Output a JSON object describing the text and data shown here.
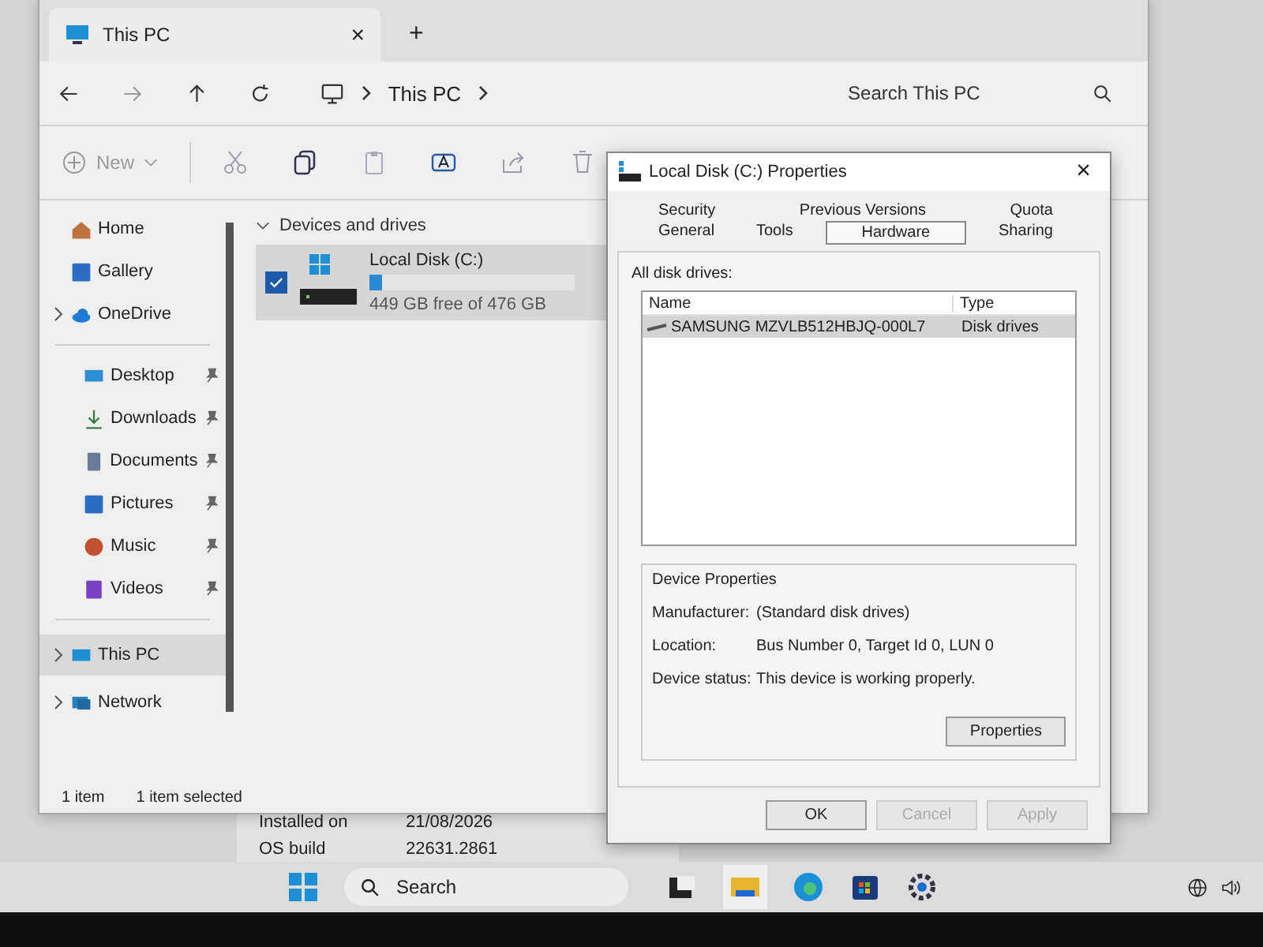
{
  "explorer": {
    "tab_title": "This PC",
    "new_tab": "+",
    "close": "×",
    "breadcrumb": "This PC",
    "search": {
      "placeholder": "Search This PC"
    },
    "new_label": "New",
    "sidebar": [
      {
        "label": "Home",
        "expandable": false,
        "pinned": false,
        "selected": false
      },
      {
        "label": "Gallery",
        "expandable": false,
        "pinned": false,
        "selected": false
      },
      {
        "label": "OneDrive",
        "expandable": true,
        "pinned": false,
        "selected": false
      },
      {
        "label": "Desktop",
        "expandable": false,
        "pinned": true,
        "selected": false
      },
      {
        "label": "Downloads",
        "expandable": false,
        "pinned": true,
        "selected": false
      },
      {
        "label": "Documents",
        "expandable": false,
        "pinned": true,
        "selected": false
      },
      {
        "label": "Pictures",
        "expandable": false,
        "pinned": true,
        "selected": false
      },
      {
        "label": "Music",
        "expandable": false,
        "pinned": true,
        "selected": false
      },
      {
        "label": "Videos",
        "expandable": false,
        "pinned": true,
        "selected": false
      },
      {
        "label": "This PC",
        "expandable": true,
        "pinned": false,
        "selected": true
      },
      {
        "label": "Network",
        "expandable": true,
        "pinned": false,
        "selected": false
      }
    ],
    "section": "Devices and drives",
    "drives": [
      {
        "name": "Local Disk (C:)",
        "free": "449 GB free of 476 GB",
        "level": 0.06,
        "checked": true,
        "selected": true
      }
    ],
    "status": [
      "1 item",
      "1 item selected"
    ]
  },
  "settings_behind": {
    "rows": [
      {
        "label": "Installed on",
        "value": "21/08/2026"
      },
      {
        "label": "OS build",
        "value": "22631.2861"
      }
    ]
  },
  "dialog": {
    "title": "Local Disk (C:) Properties",
    "close": "×",
    "tab_rows": [
      [
        {
          "label": "Security",
          "selected": false
        },
        {
          "label": "Previous Versions",
          "selected": false
        },
        {
          "label": "Quota",
          "selected": false
        }
      ],
      [
        {
          "label": "General",
          "selected": false
        },
        {
          "label": "Tools",
          "selected": false
        },
        {
          "label": "Hardware",
          "selected": true
        },
        {
          "label": "Sharing",
          "selected": false
        }
      ]
    ],
    "list_label": "All disk drives:",
    "columns": [
      "Name",
      "Type"
    ],
    "rows": [
      {
        "name": "SAMSUNG MZVLB512HBJQ-000L7",
        "type": "Disk drives",
        "selected": true
      }
    ],
    "group": "Device Properties",
    "props": [
      {
        "label": "Manufacturer:",
        "value": "(Standard disk drives)"
      },
      {
        "label": "Location:",
        "value": "Bus Number 0, Target Id 0, LUN 0"
      },
      {
        "label": "Device status:",
        "value": "This device is working properly."
      }
    ],
    "properties_button": "Properties",
    "buttons": [
      {
        "label": "OK",
        "disabled": false
      },
      {
        "label": "Cancel",
        "disabled": true
      },
      {
        "label": "Apply",
        "disabled": true
      }
    ]
  },
  "taskbar": {
    "search_placeholder": "Search"
  }
}
